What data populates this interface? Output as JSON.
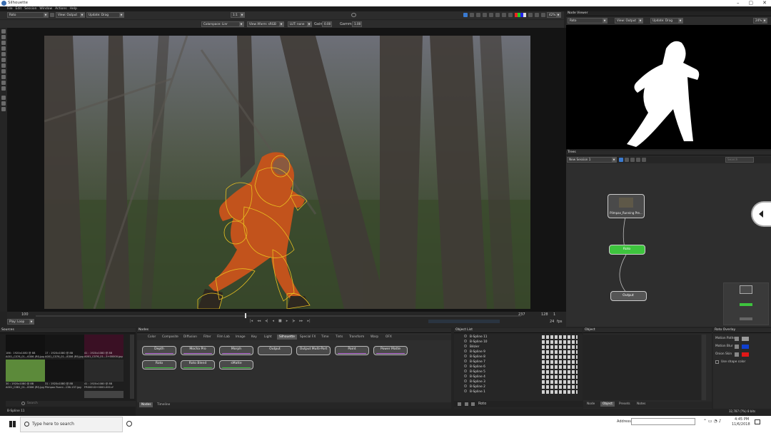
{
  "app": {
    "title": "Silhouette"
  },
  "window": {
    "min": "–",
    "max": "▢",
    "close": "✕"
  },
  "menu": [
    "File",
    "Edit",
    "Session",
    "Window",
    "Actions",
    "Help"
  ],
  "toolbar": {
    "node": "Roto",
    "view": "View: Output",
    "update": "Update: Drag",
    "ratio": "1:1",
    "zoom": "42%",
    "colorspace": "Colorspace: Linr",
    "view_xform": "View Xform: sRGB",
    "lut": "LUT: none",
    "gain_label": "Gain",
    "gain_value": "0.00",
    "gamma_label": "Gamma",
    "gamma_value": "1.00"
  },
  "node_viewer": {
    "title": "Node Viewer",
    "node": "Roto",
    "view": "View: Output",
    "update": "Update: Drag",
    "zoom": "24%"
  },
  "timeline": {
    "start": "100",
    "end": "237",
    "current": "128",
    "step": "1",
    "fps": "24",
    "fps_label": "fps",
    "loop_mode": "Play: Loop"
  },
  "trees": {
    "title": "Trees",
    "tree_name": "New Session 1",
    "search_placeholder": "Search",
    "nodes": {
      "source": "Pilmpax_Running Pre...",
      "roto": "Roto",
      "output": "Output"
    }
  },
  "sources": {
    "title": "Sources",
    "items": [
      {
        "res": "186 : 1920x1080 @ 8B",
        "name": "A001_C076_01...6306 (Rf).jpg"
      },
      {
        "res": "17 : 1920x1080 @ 8B",
        "name": "A001_C076_01...8306 (Rf).jpg"
      },
      {
        "res": "41 : 1920x1080 @ 8B",
        "name": "A001_C076_01...3+00000.jpg"
      },
      {
        "res": "30 : 1920x1080 @ 8B",
        "name": "A001_C081_01...8306 (Rf).jpg"
      },
      {
        "res": "31 : 1920x1080 @ 8B",
        "name": "Pilmpax Runni...136-137.jpg"
      },
      {
        "res": "41 : 1920x1080 @ 8B",
        "name": "FR0001D+0000-000.rf"
      }
    ],
    "search_placeholder": "Search",
    "status": "B-Spline 11"
  },
  "nodes_panel": {
    "title": "Nodes",
    "tabs": [
      "Color",
      "Composite",
      "Diffusion",
      "Filter",
      "Film Lab",
      "Image",
      "Key",
      "Light",
      "Silhouette",
      "Special FX",
      "Time",
      "Tints",
      "Transform",
      "Warp",
      "OFX"
    ],
    "active_tab": "Silhouette",
    "buttons": [
      "Depth",
      "Mocha Pro",
      "Morph",
      "Output",
      "Output Multi-Part",
      "Paint",
      "Power Matte",
      "Roto",
      "Roto Blend",
      "sMatte"
    ],
    "bottom_tabs": [
      "Nodes",
      "Timeline"
    ]
  },
  "object_list": {
    "title": "Object List",
    "items": [
      "B-Spline 11",
      "B-Spline 10",
      "Bézier",
      "B-Spline 9",
      "B-Spline 8",
      "B-Spline 7",
      "B-Spline 6",
      "B-Spline 5",
      "B-Spline 4",
      "B-Spline 3",
      "B-Spline 2",
      "B-Spline 1"
    ],
    "footer_label": "Roto"
  },
  "object": {
    "title": "Object",
    "tabs": [
      "Node",
      "Object",
      "Presets",
      "Notes"
    ],
    "active_tab": "Object"
  },
  "roto_overlay": {
    "title": "Roto Overlay",
    "rows": [
      {
        "label": "Motion Paths",
        "color": "#9a9a9a"
      },
      {
        "label": "Motion Blur",
        "color": "#1040d0"
      },
      {
        "label": "Onion Skin",
        "color": "#e01818"
      }
    ],
    "use_shape_color": "Use shape color"
  },
  "status_bar": {
    "memory": "32,787 (7%) 8 bits"
  },
  "taskbar": {
    "search_placeholder": "Type here to search",
    "address_label": "Address",
    "time": "4:45 PM",
    "date": "11/6/2018"
  },
  "colors": {
    "accent_green": "#3ec43e",
    "roto_outline": "#e8c020"
  }
}
